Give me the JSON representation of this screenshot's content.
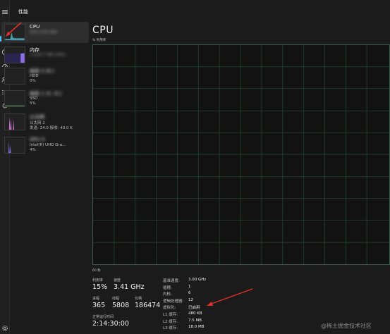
{
  "app": {
    "title": "性能"
  },
  "rail": {
    "icons": [
      "menu-icon",
      "processes-icon",
      "performance-icon",
      "app-history-icon",
      "startup-apps-icon",
      "users-icon",
      "details-icon",
      "services-icon",
      "settings-icon"
    ]
  },
  "sidebar": {
    "items": [
      {
        "name": "CPU",
        "line2": "15% 3.41 GHz",
        "line3": ""
      },
      {
        "name": "内存",
        "line2": "2.1/15.7 GB (14%)",
        "line3": ""
      },
      {
        "name": "磁盘 0 (E:)",
        "line2": "HDD",
        "line3": "0%"
      },
      {
        "name": "磁盘 1 (C: D:)",
        "line2": "SSD",
        "line3": "5%"
      },
      {
        "name": "以太网",
        "line2": "以太网 2",
        "line3": "发送: 24.0  接收: 40.0 K"
      },
      {
        "name": "GPU 0",
        "line2": "Intel(R) UHD Gra...",
        "line3": "4%"
      }
    ]
  },
  "main": {
    "title": "CPU",
    "subtitle": "% 利用率",
    "time_axis": "60 秒"
  },
  "stats": {
    "util_label": "利用率",
    "util_value": "15%",
    "speed_label": "速度",
    "speed_value": "3.41 GHz",
    "proc_label": "进程",
    "proc_value": "365",
    "thread_label": "线程",
    "thread_value": "5808",
    "handle_label": "句柄",
    "handle_value": "186474",
    "uptime_label": "正常运行时间",
    "uptime_value": "2:14:30:00"
  },
  "specs": [
    {
      "k": "基准速度:",
      "v": "3.00 GHz"
    },
    {
      "k": "插槽:",
      "v": "1"
    },
    {
      "k": "内核:",
      "v": "6"
    },
    {
      "k": "逻辑处理器:",
      "v": "12"
    },
    {
      "k": "虚拟化:",
      "v": "已启用"
    },
    {
      "k": "L1 缓存:",
      "v": "480 KB"
    },
    {
      "k": "L2 缓存:",
      "v": "7.5 MB"
    },
    {
      "k": "L3 缓存:",
      "v": "18.0 MB"
    }
  ],
  "watermark": "@稀土掘金技术社区",
  "colors": {
    "cpu": "#4fb0c6",
    "memory": "#8a6fe8",
    "network": "#d978d9",
    "gpu": "#8a6fe8",
    "accent": "#4cc2ff",
    "arrow": "#e0302a"
  }
}
